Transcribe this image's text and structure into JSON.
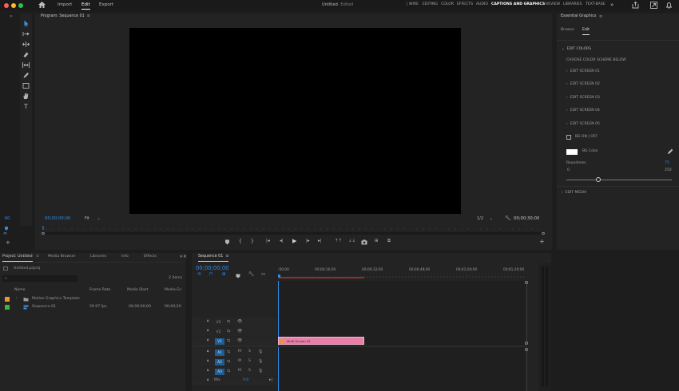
{
  "menubar": {
    "menus": [
      "Import",
      "Edit",
      "Export"
    ],
    "active_menu": "Edit",
    "title": "Untitled",
    "subtitle": "Edited",
    "workspaces": [
      "WIRE",
      "EDITING",
      "COLOR",
      "EFFECTS",
      "AUDIO",
      "CAPTIONS AND GRAPHICS",
      "REVIEW",
      "LIBRARIES",
      "TEXT-BASE"
    ],
    "active_workspace": "CAPTIONS AND GRAPHICS"
  },
  "program": {
    "title": "Program: Sequence 01",
    "timecode_left": "00;00;00;00",
    "fit": "Fit",
    "resolution": "1/2",
    "timecode_right": "00;00;30;00",
    "left_counter": "60"
  },
  "essential_graphics": {
    "title": "Essential Graphics",
    "tabs": [
      "Browse",
      "Edit"
    ],
    "active_tab": "Edit",
    "section": "EDIT COLORS",
    "choose": "CHOOSE COLOR SCHEME BELOW",
    "screens": [
      "EDIT SCREEN 01",
      "EDIT SCREEN 02",
      "EDIT SCREEN 03",
      "EDIT SCREEN 04",
      "EDIT SCREEN 05"
    ],
    "bg_toggle": "BG ON | OFF",
    "bg_color_label": "BG Color",
    "roundness_label": "Roundness",
    "roundness_value": "75",
    "roundness_min": "0",
    "roundness_max": "250",
    "roundness_fraction": 0.3,
    "edit_media": "EDIT MEDIA",
    "bg_color": "#ffffff"
  },
  "project": {
    "tabs": [
      "Project: Untitled",
      "Media Browser",
      "Libraries",
      "Info",
      "Effects"
    ],
    "active_tab": "Project: Untitled",
    "file": "Untitled.prproj",
    "items_count": "2 items",
    "columns": [
      "Name",
      "Frame Rate",
      "Media Start",
      "Media En"
    ],
    "rows": [
      {
        "name": "Motion Graphics Template",
        "rate": "",
        "start": "",
        "end": "",
        "color": "#e39a2f"
      },
      {
        "name": "Sequence 01",
        "rate": "29.97 fps",
        "start": "00;00;00;00",
        "end": "00;00;29",
        "color": "#3fb53f"
      }
    ]
  },
  "timeline": {
    "title": "Sequence 01",
    "timecode": "00;00;00;00",
    "ruler": [
      ":00;00",
      "00;00;16;00",
      "00;00;32;00",
      "00;00;48;00",
      "00;01;04;00",
      "00;01;20;00"
    ],
    "video_tracks": [
      "V3",
      "V2",
      "V1"
    ],
    "audio_tracks": [
      "A1",
      "A2",
      "A3"
    ],
    "mix_label": "Mix",
    "mix_value": "0.0",
    "clip_label": "Multi Screen 03",
    "clip_color": "#e87ea9"
  },
  "colors": {
    "accent": "#2d8ceb",
    "playhead_region": "#c0392b"
  }
}
